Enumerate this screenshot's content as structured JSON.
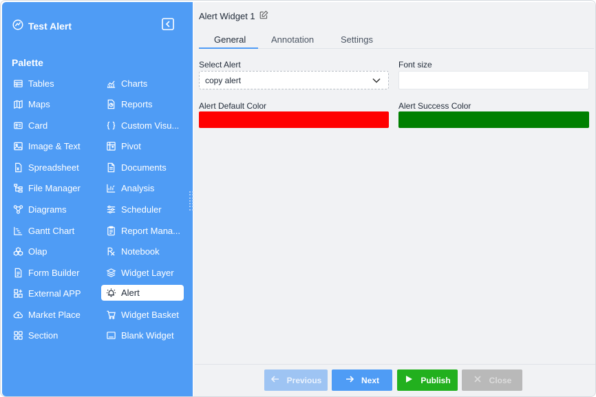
{
  "app": {
    "title": "Test Alert"
  },
  "palette": {
    "title": "Palette",
    "left": [
      {
        "label": "Tables",
        "icon": "table-icon"
      },
      {
        "label": "Maps",
        "icon": "map-icon"
      },
      {
        "label": "Card",
        "icon": "card-icon"
      },
      {
        "label": "Image & Text",
        "icon": "image-icon"
      },
      {
        "label": "Spreadsheet",
        "icon": "spreadsheet-icon"
      },
      {
        "label": "File Manager",
        "icon": "file-manager-icon"
      },
      {
        "label": "Diagrams",
        "icon": "diagram-icon"
      },
      {
        "label": "Gantt Chart",
        "icon": "gantt-icon"
      },
      {
        "label": "Olap",
        "icon": "olap-icon"
      },
      {
        "label": "Form Builder",
        "icon": "form-icon"
      },
      {
        "label": "External APP",
        "icon": "external-app-icon"
      },
      {
        "label": "Market Place",
        "icon": "cloud-upload-icon"
      },
      {
        "label": "Section",
        "icon": "section-icon"
      }
    ],
    "right": [
      {
        "label": "Charts",
        "icon": "chart-icon"
      },
      {
        "label": "Reports",
        "icon": "report-icon"
      },
      {
        "label": "Custom Visu...",
        "icon": "braces-icon"
      },
      {
        "label": "Pivot",
        "icon": "pivot-icon"
      },
      {
        "label": "Documents",
        "icon": "document-icon"
      },
      {
        "label": "Analysis",
        "icon": "analysis-icon"
      },
      {
        "label": "Scheduler",
        "icon": "scheduler-icon"
      },
      {
        "label": "Report Mana...",
        "icon": "clipboard-icon"
      },
      {
        "label": "Notebook",
        "icon": "rx-icon"
      },
      {
        "label": "Widget Layer",
        "icon": "layers-icon"
      },
      {
        "label": "Alert",
        "icon": "alert-bell-icon",
        "active": true
      },
      {
        "label": "Widget Basket",
        "icon": "basket-icon"
      },
      {
        "label": "Blank Widget",
        "icon": "blank-widget-icon"
      }
    ]
  },
  "widget": {
    "title": "Alert Widget 1",
    "tabs": [
      "General",
      "Annotation",
      "Settings"
    ],
    "active_tab": "General",
    "select_alert": {
      "label": "Select Alert",
      "value": "copy alert"
    },
    "font_size": {
      "label": "Font size",
      "value": ""
    },
    "default_color": {
      "label": "Alert Default Color",
      "value": "#ff0000"
    },
    "success_color": {
      "label": "Alert Success Color",
      "value": "#008000"
    }
  },
  "footer": {
    "previous": "Previous",
    "next": "Next",
    "publish": "Publish",
    "close": "Close"
  }
}
